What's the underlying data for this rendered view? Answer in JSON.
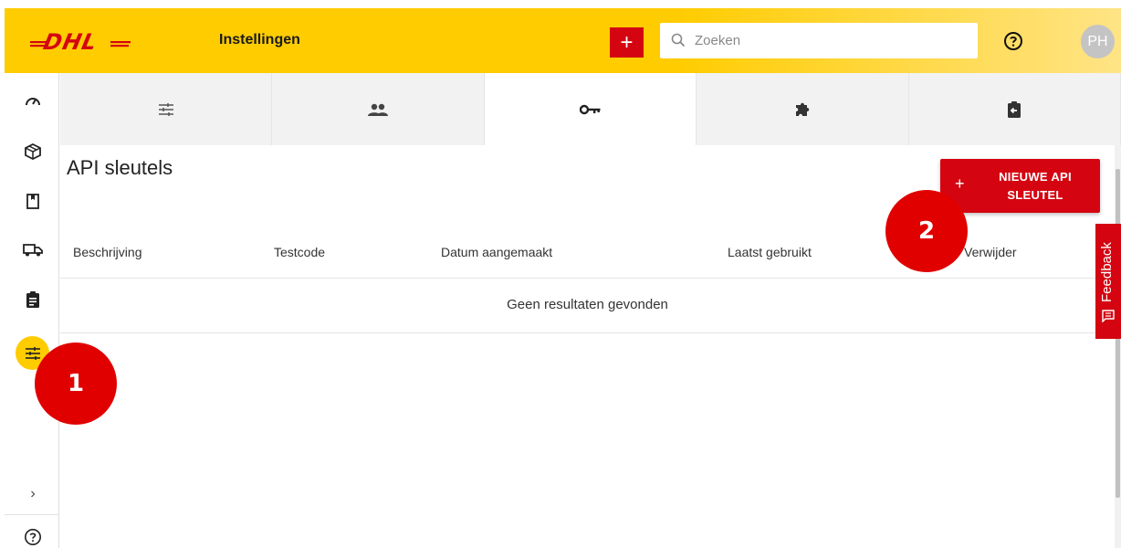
{
  "header": {
    "title": "Instellingen",
    "add_label": "+",
    "search_placeholder": "Zoeken",
    "avatar_initials": "PH"
  },
  "brand": {
    "logo_text": "DHL",
    "yellow": "#ffcc00",
    "red": "#d40511"
  },
  "sidebar": {
    "items": [
      {
        "icon": "dashboard-gauge-icon"
      },
      {
        "icon": "package-icon"
      },
      {
        "icon": "bookmark-icon"
      },
      {
        "icon": "truck-icon"
      },
      {
        "icon": "clipboard-icon"
      },
      {
        "icon": "settings-sliders-icon",
        "active": true
      }
    ],
    "expand_label": "›",
    "help_icon": "help-icon"
  },
  "tabs": [
    {
      "icon": "settings-sliders-icon",
      "active": false
    },
    {
      "icon": "users-icon",
      "active": false
    },
    {
      "icon": "key-icon",
      "active": true
    },
    {
      "icon": "puzzle-icon",
      "active": false
    },
    {
      "icon": "clipboard-return-icon",
      "active": false
    }
  ],
  "main": {
    "title": "API sleutels",
    "new_button": {
      "plus": "+",
      "label": "NIEUWE API SLEUTEL"
    },
    "columns": [
      "Beschrijving",
      "Testcode",
      "Datum aangemaakt",
      "Laatst gebruikt",
      "Verwijder"
    ],
    "empty_message": "Geen resultaten gevonden"
  },
  "feedback_label": "Feedback",
  "markers": [
    "1",
    "2"
  ]
}
